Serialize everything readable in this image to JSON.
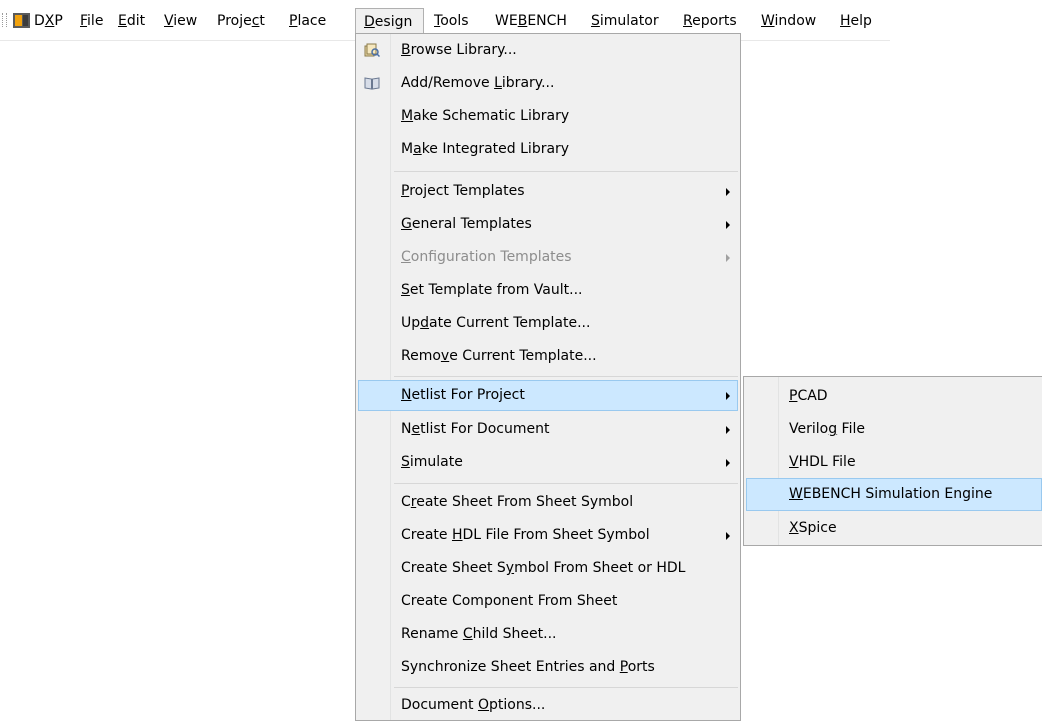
{
  "menubar": {
    "items": [
      {
        "label": "DXP",
        "underline": 1
      },
      {
        "label": "File",
        "underline": 0
      },
      {
        "label": "Edit",
        "underline": 0
      },
      {
        "label": "View",
        "underline": 0
      },
      {
        "label": "Project",
        "underline": 5
      },
      {
        "label": "Place",
        "underline": 0
      },
      {
        "label": "Design",
        "underline": 0
      },
      {
        "label": "Tools",
        "underline": 0
      },
      {
        "label": "WEBENCH",
        "underline": 2
      },
      {
        "label": "Simulator",
        "underline": 0
      },
      {
        "label": "Reports",
        "underline": 0
      },
      {
        "label": "Window",
        "underline": 0
      },
      {
        "label": "Help",
        "underline": 0
      }
    ],
    "active": "Design"
  },
  "design_menu": {
    "items": [
      {
        "label": "Browse Library...",
        "underline": 0,
        "icon": "browse-library-icon"
      },
      {
        "label": "Add/Remove Library...",
        "underline": 11,
        "icon": "library-book-icon"
      },
      {
        "label": "Make Schematic Library",
        "underline": 0
      },
      {
        "label": "Make Integrated Library",
        "underline": 1
      },
      {
        "label": "Project Templates",
        "underline": 0,
        "submenu": true
      },
      {
        "label": "General Templates",
        "underline": 0,
        "submenu": true
      },
      {
        "label": "Configuration Templates",
        "underline": 0,
        "submenu": true,
        "disabled": true
      },
      {
        "label": "Set Template from Vault...",
        "underline": 0
      },
      {
        "label": "Update Current Template...",
        "underline": 2
      },
      {
        "label": "Remove Current Template...",
        "underline": 4
      },
      {
        "label": "Netlist For Project",
        "underline": 0,
        "submenu": true,
        "highlighted": true
      },
      {
        "label": "Netlist For Document",
        "underline": 1,
        "submenu": true
      },
      {
        "label": "Simulate",
        "underline": 0,
        "submenu": true
      },
      {
        "label": "Create Sheet From Sheet Symbol",
        "underline": 1
      },
      {
        "label": "Create HDL File From Sheet Symbol",
        "underline": 7,
        "submenu": true
      },
      {
        "label": "Create Sheet Symbol From Sheet or HDL",
        "underline": 14
      },
      {
        "label": "Create Component From Sheet",
        "underline": -1
      },
      {
        "label": "Rename Child Sheet...",
        "underline": 7
      },
      {
        "label": "Synchronize Sheet Entries and Ports",
        "underline": 30
      },
      {
        "label": "Document Options...",
        "underline": 9
      }
    ]
  },
  "netlist_submenu": {
    "items": [
      {
        "label": "PCAD",
        "underline": 0
      },
      {
        "label": "Verilog File",
        "underline": 6
      },
      {
        "label": "VHDL File",
        "underline": 0
      },
      {
        "label": "WEBENCH Simulation Engine",
        "underline": 0,
        "highlighted": true
      },
      {
        "label": "XSpice",
        "underline": 0
      }
    ]
  },
  "colors": {
    "menu_bg": "#f0f0f0",
    "highlight_bg": "#cce8ff",
    "highlight_border": "#99c9ef",
    "disabled_text": "#8d8d8d"
  }
}
